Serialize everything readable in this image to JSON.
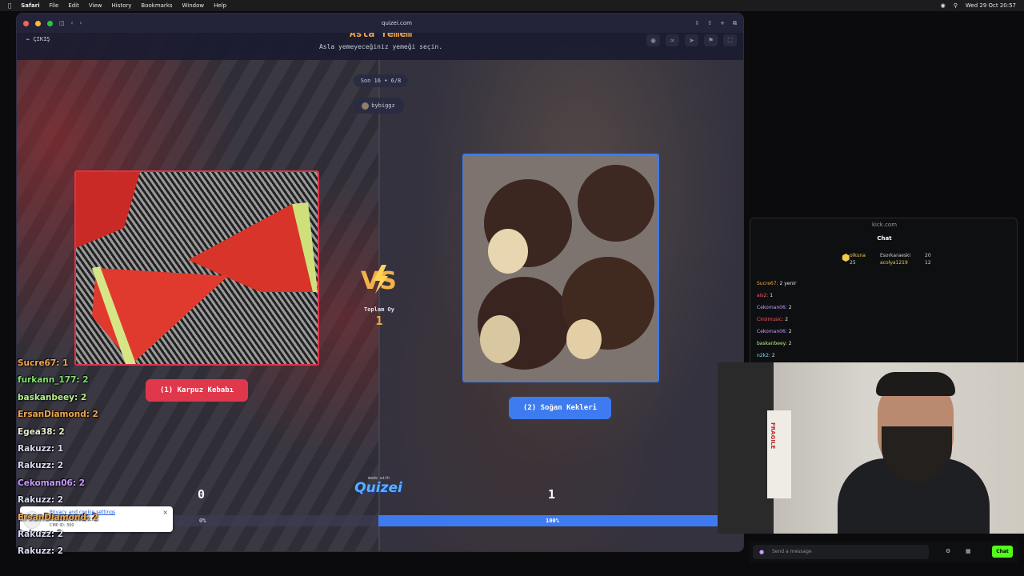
{
  "menubar": {
    "app": "Safari",
    "items": [
      "File",
      "Edit",
      "View",
      "History",
      "Bookmarks",
      "Window",
      "Help"
    ],
    "datetime": "Wed 29 Oct  20:57"
  },
  "browser": {
    "url": "quizei.com"
  },
  "game": {
    "exit_label": "ÇIKIŞ",
    "title": "Asla Yemem",
    "subtitle": "Asla yemeyeceğiniz yemeği seçin.",
    "round": "Son 16 • 6/8",
    "user": "bybiggz",
    "left_option": "(1) Karpuz Kebabı",
    "right_option": "(2) Soğan Kekleri",
    "total_label": "Toplam Oy",
    "total_value": "1",
    "made_with": "made with",
    "logo_text": "Quizei",
    "left_votes": "0",
    "right_votes": "1",
    "left_pct_label": "0%",
    "right_pct_label": "100%",
    "right_share": 1.0
  },
  "cookie": {
    "title": "Privacy and cookie settings",
    "text": "Complies with IAB TCF.",
    "id": "CMP ID: 300",
    "close": "×"
  },
  "leaderboard": [
    "Sucre67: 1",
    "furkann_177: 2",
    "baskanbeey: 2",
    "ErsanDiamond: 2",
    "Egea38: 2",
    "Rakuzz: 1",
    "Rakuzz: 2",
    "Cekoman06: 2",
    "Rakuzz: 2",
    "ErsanDiamond: 2",
    "Rakuzz: 2",
    "Rakuzz: 2"
  ],
  "kick": {
    "url": "kick.com",
    "chat_title": "Chat",
    "top_left_name": "olkuna",
    "top_left_count": "25",
    "top_right_name1": "Esorkaraeski",
    "top_right_count1": "20",
    "top_right_name2": "acolya1219",
    "top_right_count2": "12",
    "messages": [
      {
        "user": "Sucre67:",
        "text": "2 yenir"
      },
      {
        "user": "ais2:",
        "text": "1"
      },
      {
        "user": "Cekoman06:",
        "text": "2"
      },
      {
        "user": "Ciroimusic:",
        "text": "2"
      },
      {
        "user": "Cekoman06:",
        "text": "2"
      },
      {
        "user": "baskanbeey:",
        "text": "2"
      },
      {
        "user": "n2k2:",
        "text": "2"
      }
    ],
    "send_placeholder": "Send a message",
    "chat_button": "Chat"
  },
  "webcam": {
    "box_text": "FRAGILE"
  },
  "colors": {
    "accent_red": "#e0374b",
    "accent_blue": "#3e7bf0",
    "title_orange": "#f2a64a",
    "kick_green": "#53fc18"
  }
}
